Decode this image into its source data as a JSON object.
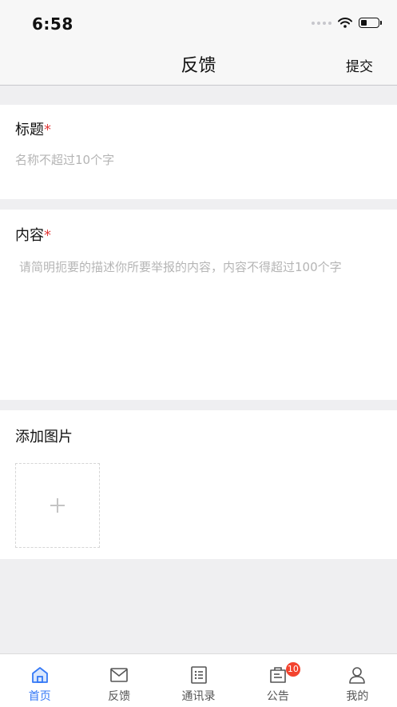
{
  "status_bar": {
    "time": "6:58"
  },
  "nav": {
    "title": "反馈",
    "submit_label": "提交"
  },
  "form": {
    "title_section": {
      "label": "标题",
      "required_mark": "*",
      "placeholder": "名称不超过10个字"
    },
    "content_section": {
      "label": "内容",
      "required_mark": "*",
      "placeholder": "请简明扼要的描述你所要举报的内容，内容不得超过100个字"
    },
    "image_section": {
      "label": "添加图片"
    }
  },
  "tabbar": {
    "accent_color": "#3478f6",
    "inactive_color": "#555555",
    "badge_color": "#f3432e",
    "items": [
      {
        "label": "首页",
        "icon": "home-icon",
        "active": true
      },
      {
        "label": "反馈",
        "icon": "mail-icon",
        "active": false
      },
      {
        "label": "通讯录",
        "icon": "contacts-list-icon",
        "active": false
      },
      {
        "label": "公告",
        "icon": "notice-icon",
        "active": false,
        "badge": "10"
      },
      {
        "label": "我的",
        "icon": "person-icon",
        "active": false
      }
    ]
  }
}
